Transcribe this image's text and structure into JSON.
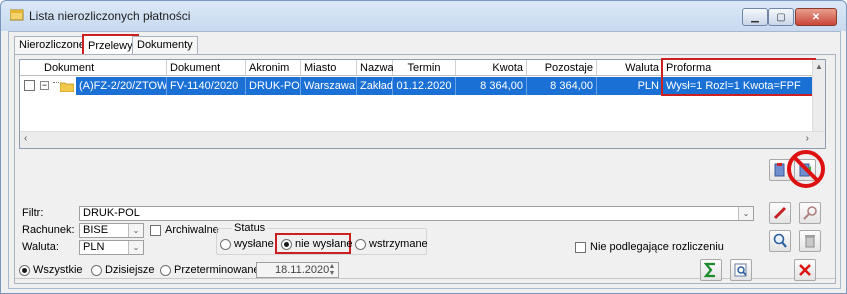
{
  "window": {
    "title": "Lista nierozliczonych płatności"
  },
  "tabs": [
    {
      "label": "Nierozliczone"
    },
    {
      "label": "Przelewy"
    },
    {
      "label": "Dokumenty"
    }
  ],
  "grid": {
    "headers": [
      "Dokument",
      "Dokument obcy",
      "Akronim",
      "Miasto",
      "Nazwa",
      "Termin",
      "Kwota",
      "Pozostaje",
      "Waluta",
      "Proforma"
    ],
    "row": {
      "dokument": "(A)FZ-2/20/ZTOW",
      "dokument_obcy": "FV-1140/2020",
      "akronim": "DRUK-POL",
      "miasto": "Warszawa",
      "nazwa": "Zakład",
      "termin": "01.12.2020",
      "kwota": "8 364,00",
      "pozostaje": "8 364,00",
      "waluta": "PLN",
      "proforma": "Wysł=1 Rozl=1 Kwota=FPF"
    }
  },
  "filters": {
    "filtr_label": "Filtr:",
    "filtr_value": "DRUK-POL",
    "rachunek_label": "Rachunek:",
    "rachunek_value": "BISE",
    "archiwalne_label": "Archiwalne",
    "waluta_label": "Waluta:",
    "waluta_value": "PLN",
    "status_label": "Status",
    "status_options": [
      "wysłane",
      "nie wysłane",
      "wstrzymane"
    ],
    "status_selected": "nie wysłane",
    "nie_podlegajace_label": "Nie podlegające rozliczeniu"
  },
  "bottom": {
    "scope_options": [
      "Wszystkie",
      "Dzisiejsze",
      "Przeterminowane"
    ],
    "scope_selected": "Wszystkie",
    "date_value": "18.11.2020"
  },
  "colors": {
    "selection": "#1a70d5",
    "highlight": "#cc1f1f"
  }
}
